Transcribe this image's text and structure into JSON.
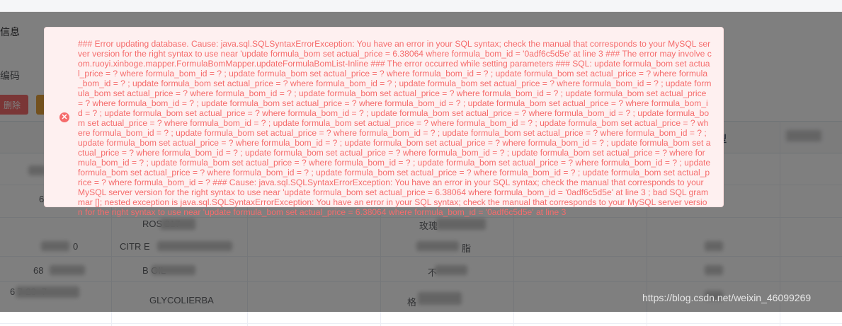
{
  "page": {
    "section_title": "信息",
    "field_label": "编码",
    "delete_button": "删除",
    "column_type": "型",
    "rows": [
      {
        "c1": "6",
        "c2": "",
        "c3": ""
      },
      {
        "c1": "",
        "c2": "ROS 217",
        "c3": "玫瑰"
      },
      {
        "c1": "0",
        "c2": "CITR E",
        "c3": "脂"
      },
      {
        "c1": "68",
        "c2": "B OIL",
        "c3": "不"
      },
      {
        "c1": "6 7-23 -7",
        "c2": "GLYCOLIERBA",
        "c3": "格"
      }
    ]
  },
  "error": {
    "icon": "close-circle-icon",
    "message": "### Error updating database. Cause: java.sql.SQLSyntaxErrorException: You have an error in your SQL syntax; check the manual that corresponds to your MySQL server version for the right syntax to use near 'update formula_bom set actual_price = 6.38064 where formula_bom_id = '0adf6c5d5e' at line 3 ### The error may involve com.ruoyi.xinboge.mapper.FormulaBomMapper.updateFormulaBomList-Inline ### The error occurred while setting parameters ### SQL: update formula_bom set actual_price = ? where formula_bom_id = ? ; update formula_bom set actual_price = ? where formula_bom_id = ? ; update formula_bom set actual_price = ? where formula_bom_id = ? ; update formula_bom set actual_price = ? where formula_bom_id = ? ; update formula_bom set actual_price = ? where formula_bom_id = ? ; update formula_bom set actual_price = ? where formula_bom_id = ? ; update formula_bom set actual_price = ? where formula_bom_id = ? ; update formula_bom set actual_price = ? where formula_bom_id = ? ; update formula_bom set actual_price = ? where formula_bom_id = ? ; update formula_bom set actual_price = ? where formula_bom_id = ? ; update formula_bom set actual_price = ? where formula_bom_id = ? ; update formula_bom set actual_price = ? where formula_bom_id = ? ; update formula_bom set actual_price = ? where formula_bom_id = ? ; update formula_bom set actual_price = ? where formula_bom_id = ? ; update formula_bom set actual_price = ? where formula_bom_id = ? ; update formula_bom set actual_price = ? where formula_bom_id = ? ; update formula_bom set actual_price = ? where formula_bom_id = ? ; update formula_bom set actual_price = ? where formula_bom_id = ? ; update formula_bom set actual_price = ? where formula_bom_id = ? ; update formula_bom set actual_price = ? where formula_bom_id = ? ; update formula_bom set actual_price = ? where formula_bom_id = ? ; update formula_bom set actual_price = ? where formula_bom_id = ? ; update formula_bom set actual_price = ? where formula_bom_id = ? ; update formula_bom set actual_price = ? where formula_bom_id = ? ; update formula_bom set actual_price = ? where formula_bom_id = ? ; update formula_bom set actual_price = ? where formula_bom_id = ? ; update formula_bom set actual_price = ? where formula_bom_id = ? ### Cause: java.sql.SQLSyntaxErrorException: You have an error in your SQL syntax; check the manual that corresponds to your MySQL server version for the right syntax to use near 'update formula_bom set actual_price = 6.38064 where formula_bom_id = '0adf6c5d5e' at line 3 ; bad SQL grammar []; nested exception is java.sql.SQLSyntaxErrorException: You have an error in your SQL syntax; check the manual that corresponds to your MySQL server version for the right syntax to use near 'update formula_bom set actual_price = 6.38064 where formula_bom_id = '0adf6c5d5e' at line 3"
  },
  "watermark": "https://blog.csdn.net/weixin_46099269",
  "colors": {
    "error_text": "#f56c6c",
    "error_bg": "#fef0f0",
    "overlay": "rgba(0,0,0,0.5)"
  }
}
